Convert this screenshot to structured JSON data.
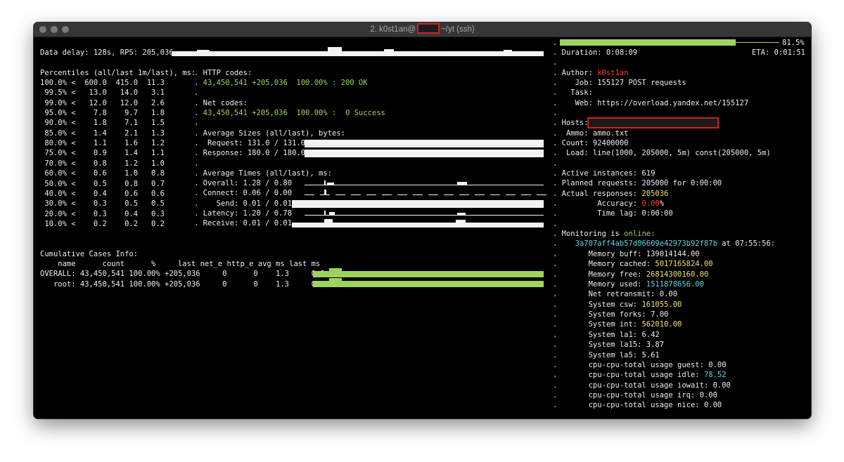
{
  "window": {
    "title_prefix": "2. k0st1an@",
    "title_suffix": "~/yt (ssh)"
  },
  "left": {
    "data_delay": "Data delay: 128s, RPS: 205,036",
    "percentiles_header": "Percentiles (all/last 1m/last), ms:",
    "percentiles": [
      "100.0% <  600.0  415.0  11.3",
      " 99.5% <   13.0   14.0   3.1",
      " 99.0% <   12.0   12.0   2.6",
      " 95.0% <    7.8    9.7   1.8",
      " 90.0% <    1.8    7.1   1.5",
      " 85.0% <    1.4    2.1   1.3",
      " 80.0% <    1.1    1.6   1.2",
      " 75.0% <    0.9    1.4   1.1",
      " 70.0% <    0.8    1.2   1.0",
      " 60.0% <    0.6    1.0   0.8",
      " 50.0% <    0.5    0.8   0.7",
      " 40.0% <    0.4    0.6   0.6",
      " 30.0% <    0.3    0.5   0.5",
      " 20.0% <    0.3    0.4   0.3",
      " 10.0% <    0.2    0.2   0.2"
    ],
    "http_codes_header": ". HTTP codes:",
    "http_code_line": "43,450,541 +205,036  100.00% : 200 OK",
    "net_codes_header": ". Net codes:",
    "net_code_line": "43,450,541 +205,036  100.00% :  0 Success",
    "avg_sizes_header": ". Average Sizes (all/last), bytes:",
    "request_size": ".  Request: 131.0 / 131.0",
    "response_size": ". Response: 180.0 / 180.0",
    "avg_times_header": ". Average Times (all/last), ms:",
    "times": [
      ". Overall: 1.28 / 0.80",
      ". Connect: 0.06 / 0.00",
      ".    Send: 0.01 / 0.01",
      ". Latency: 1.20 / 0.78",
      ". Receive: 0.01 / 0.01"
    ],
    "dot": ".",
    "cases_header": "Cumulative Cases Info:",
    "cases_columns": "    name      count      %     last net_e http_e avg ms last ms",
    "cases_rows": [
      "OVERALL: 43,450,541 100.00% +205,036     0      0    1.3     0.8",
      "   root: 43,450,541 100.00% +205,036     0      0    1.3     0.8"
    ]
  },
  "right": {
    "progress": 0.815,
    "progress_pct": "81.5%",
    "duration": ". Duration: 0:08:09",
    "eta": "ETA: 0:01:51",
    "dot": ".",
    "author_label": ". Author: ",
    "author_value": "k0st1an",
    "job": ".    Job: 155127 POST requests",
    "task": ".   Task:",
    "web": ".    Web: https://overload.yandex.net/155127",
    "hosts": ". Hosts:",
    "ammo": ".  Ammo: ammo.txt",
    "count": ". Count: 92400000",
    "load": ".  Load: line(1000, 205000, 5m) const(205000, 5m)",
    "active_instances": ". Active instances: 619",
    "planned_requests": ". Planned requests: 205000 for 0:00:00",
    "actual_label": ". Actual responses: ",
    "actual_value": "205036",
    "accuracy_label": ".         Accuracy: ",
    "accuracy_value": "0.00",
    "accuracy_suffix": "%",
    "time_lag": ".         Time lag: 0:00:00",
    "monitoring_label": ". Monitoring is ",
    "monitoring_status": "online:",
    "host_id": "3a707aff4ab57d06609e42973b92f87b",
    "host_at": " at 07:55:56:",
    "metrics": [
      {
        "label": "Memory buff: ",
        "value": "139014144.00",
        "color": "plain"
      },
      {
        "label": "Memory cached: ",
        "value": "5017165824.00",
        "color": "y"
      },
      {
        "label": "Memory free: ",
        "value": "26814300160.00",
        "color": "y"
      },
      {
        "label": "Memory used: ",
        "value": "1511878656.00",
        "color": "c"
      },
      {
        "label": "Net retransmit: ",
        "value": "0.00",
        "color": "plain"
      },
      {
        "label": "System csw: ",
        "value": "161055.00",
        "color": "y"
      },
      {
        "label": "System forks: ",
        "value": "7.00",
        "color": "plain"
      },
      {
        "label": "System int: ",
        "value": "562010.00",
        "color": "y"
      },
      {
        "label": "System la1: ",
        "value": "6.42",
        "color": "plain"
      },
      {
        "label": "System la15: ",
        "value": "3.87",
        "color": "plain"
      },
      {
        "label": "System la5: ",
        "value": "5.61",
        "color": "plain"
      },
      {
        "label": "cpu-cpu-total usage guest: ",
        "value": "0.00",
        "color": "plain"
      },
      {
        "label": "cpu-cpu-total usage idle: ",
        "value": "78.52",
        "color": "c"
      },
      {
        "label": "cpu-cpu-total usage iowait: ",
        "value": "0.00",
        "color": "plain"
      },
      {
        "label": "cpu-cpu-total usage irq: ",
        "value": "0.00",
        "color": "plain"
      },
      {
        "label": "cpu-cpu-total usage nice: ",
        "value": "0.00",
        "color": "plain"
      }
    ]
  },
  "colors": {
    "green": "#9ed35d",
    "red": "#ff3b3b",
    "yellow": "#f3e16f",
    "cyan": "#5fd7e3"
  }
}
